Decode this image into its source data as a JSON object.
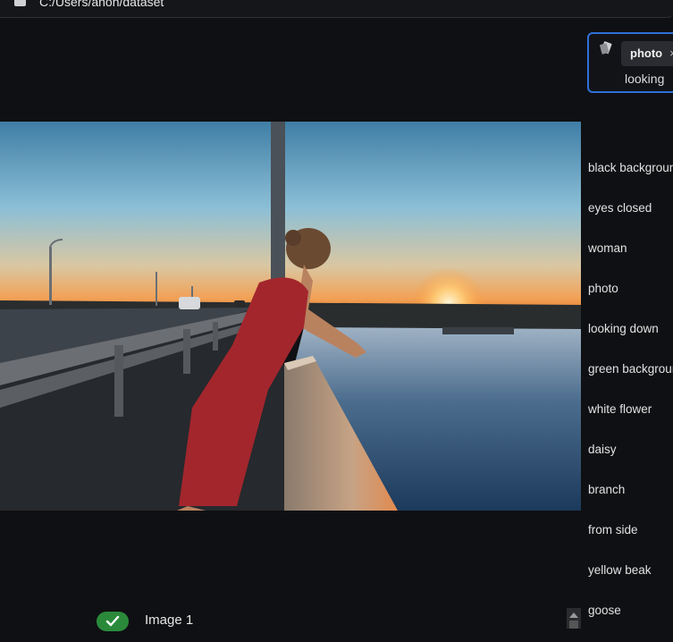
{
  "pathbar": {
    "path": "C:/Users/anon/dataset",
    "icon": "folder-icon"
  },
  "filter": {
    "icon": "tag-icon",
    "chip_label": "photo",
    "chip_close": "×",
    "input_value": "looking"
  },
  "image": {
    "caption": "Image 1",
    "status_icon": "check-icon"
  },
  "tags": [
    "black background",
    "eyes closed",
    "woman",
    "photo",
    "looking down",
    "green background",
    "white flower",
    "daisy",
    "branch",
    "from side",
    "yellow beak",
    "goose"
  ],
  "colors": {
    "accent": "#2f6fd6",
    "success": "#2a8a3a",
    "background": "#0f1013"
  }
}
